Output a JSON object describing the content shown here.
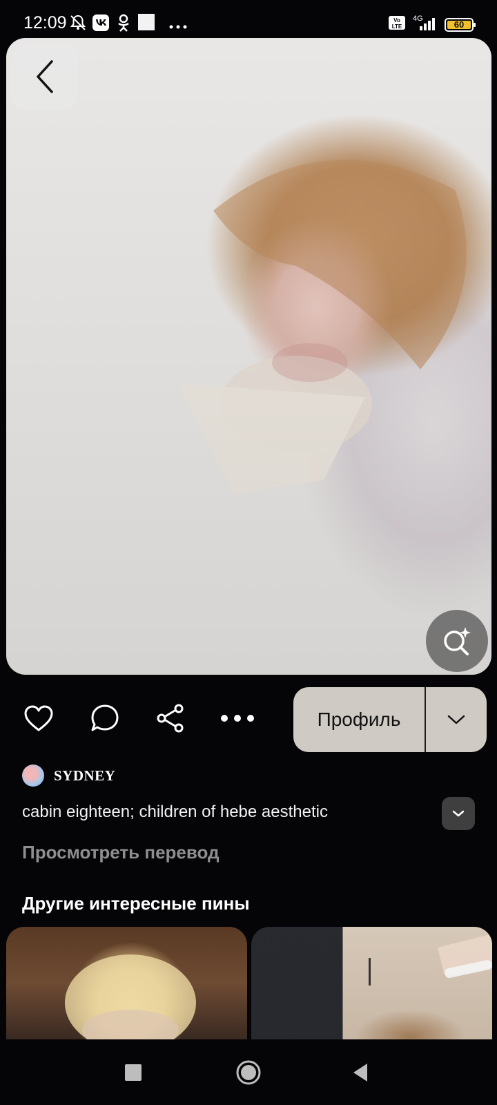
{
  "status_bar": {
    "time": "12:09",
    "battery": "60",
    "network": "4G",
    "volte": "Vo LTE",
    "icons": [
      "bell-muted-icon",
      "vk-icon",
      "odnoklassniki-icon",
      "notification-square-icon",
      "more-dots-icon",
      "signal-icon",
      "battery-icon"
    ]
  },
  "pin": {
    "image_alt": "pin-photo",
    "author_name": "SYDNEY",
    "description": "cabin eighteen; children of hebe aesthetic",
    "translate_label": "Просмотреть перевод"
  },
  "actions": {
    "profile_label": "Профиль",
    "icons": [
      "heart-icon",
      "comment-icon",
      "share-icon",
      "more-icon",
      "chevron-down-icon"
    ]
  },
  "more_section": {
    "title": "Другие интересные пины"
  },
  "colors": {
    "background": "#050407",
    "profile_button": "#cfcac4",
    "translate_text": "#8e8e8e"
  }
}
